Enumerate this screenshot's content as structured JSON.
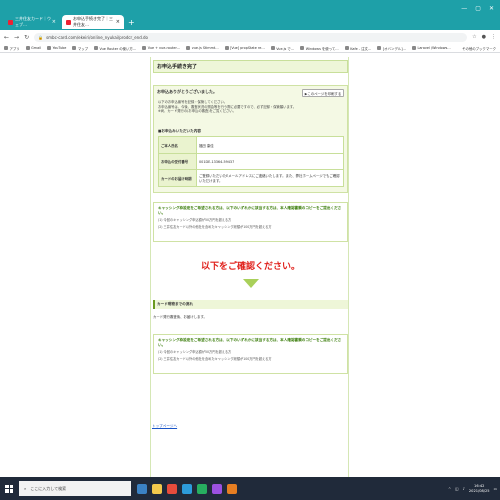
{
  "browser": {
    "tabs": [
      {
        "label": "三井住友カード｜ウェブ…"
      },
      {
        "label": "お申込手続き完了｜三井住友…"
      }
    ],
    "url": "smbc-card.com/ekeiri/online_nyukai/prodcr_end.do",
    "bookmarks": [
      "アプリ",
      "Gmail",
      "YouTube",
      "マップ",
      "Vue Router の使い方…",
      "Vue + vue-router…",
      "vue.js Stimmt…",
      "[Vue] propState re…",
      "Vue.js で…",
      "Windows を使って…",
      "Kafe - 注文…",
      "[オバンデル]…",
      "Laravel /Windows…"
    ],
    "other_bookmarks": "その他のブックマーク"
  },
  "page": {
    "title": "お申込手続き完了",
    "thanks": "お申込ありがとうございました。",
    "notes": [
      "以下のお申込番号を記録・保管してください。",
      "お申込番号は、今後、審査状況の照会等を行う際に必要ですので、必ず記録・保管願います。",
      "※尚、カード発行の(お申込の審査)をご覧ください。"
    ],
    "home_button": "▶このページを印刷する",
    "details_heading": "■お申込みいただいた内容",
    "details": [
      {
        "label": "ご本人氏名",
        "value": "福田 康佳"
      },
      {
        "label": "お申込の受付番号",
        "value": "001DE-13364-59437"
      },
      {
        "label": "カードのお届け時期",
        "value": "ご登録いただいたEメールアドレスにご連絡いたします。また、弊社ホームページでもご確認いただけます。"
      }
    ],
    "warning": {
      "heading": "キャッシング枠設定をご希望される方は、以下のいずれかに該当する方は、本人確認書類のコピーをご提出ください。",
      "items": [
        "(1) 今回のキャッシング申込額が50万円を超える方",
        "(2) 三井住友カード以外の他社を含めたキャッシング総額が100万円を超える方"
      ]
    },
    "confirm_text": "以下をご確認ください。",
    "section_heading": "カード現物までの流れ",
    "section_text": "カード発行審査後、お届けします。",
    "warning2": {
      "heading": "キャッシング枠設定をご希望される方は、以下のいずれかに該当する方は、本人確認書類のコピーをご提出ください。",
      "items": [
        "(1) 今回のキャッシング申込額が50万円を超える方",
        "(2) 三井住友カード以外の他社を含めたキャッシング総額が100万円を超える方"
      ]
    },
    "top_link": "トップページへ"
  },
  "taskbar": {
    "search_placeholder": "ここに入力して検索",
    "time": "16:42",
    "date": "2021/08/25"
  },
  "colors": {
    "chrome": "#1ea0a8",
    "accent_green": "#a9d05a",
    "alert_red": "#e0201b"
  }
}
